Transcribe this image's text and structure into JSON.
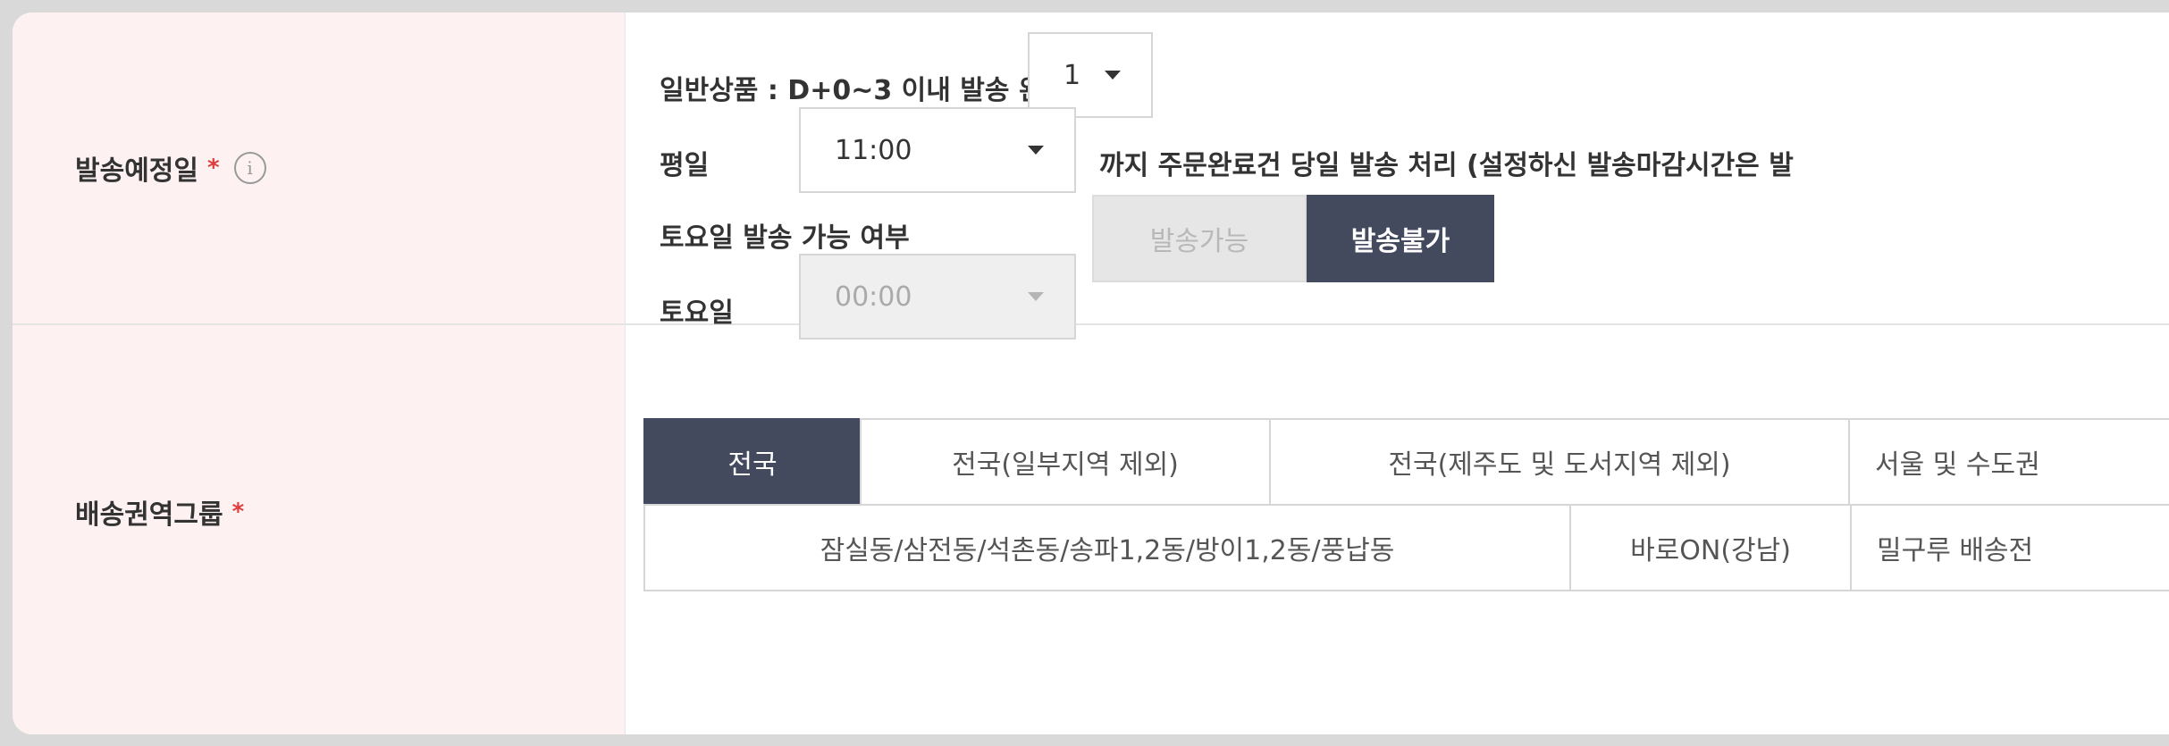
{
  "shipping_date": {
    "label": "발송예정일",
    "required_mark": "*",
    "info_icon": "info-icon",
    "general_product_text": "일반상품 : D+0~3 이내 발송 완료",
    "general_product_select": "1",
    "weekday_label": "평일",
    "weekday_time_select": "11:00",
    "weekday_suffix": "까지 주문완료건 당일 발송 처리 (설정하신 발송마감시간은 발",
    "saturday_available_label": "토요일 발송 가능 여부",
    "saturday_options": [
      "발송가능",
      "발송불가"
    ],
    "saturday_selected": "발송불가",
    "saturday_label": "토요일",
    "saturday_time_select": "00:00"
  },
  "delivery_zone": {
    "label": "배송권역그룹",
    "required_mark": "*",
    "tabs_row1": [
      "전국",
      "전국(일부지역 제외)",
      "전국(제주도 및 도서지역 제외)",
      "서울 및 수도권"
    ],
    "tabs_row2": [
      "잠실동/삼전동/석촌동/송파1,2동/방이1,2동/풍납동",
      "바로ON(강남)",
      "밀구루 배송전"
    ],
    "active_tab": "전국"
  },
  "colors": {
    "label_bg": "#fdf1f1",
    "active_bg": "#434a5e",
    "required": "#e03c3c"
  }
}
